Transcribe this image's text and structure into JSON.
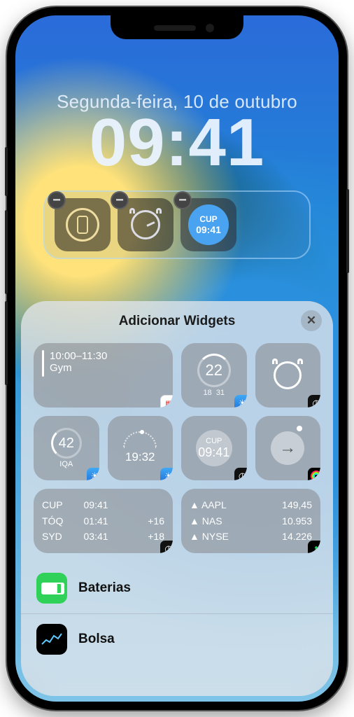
{
  "lockscreen": {
    "date": "Segunda-feira, 10 de outubro",
    "time": "09:41",
    "widgets": [
      {
        "kind": "phone-circle"
      },
      {
        "kind": "alarm"
      },
      {
        "kind": "worldclock",
        "city": "CUP",
        "time": "09:41"
      }
    ],
    "remove_glyph": "−"
  },
  "sheet": {
    "title": "Adicionar Widgets",
    "close_glyph": "✕",
    "grid": {
      "calendar_event": {
        "time": "10:00–11:30",
        "title": "Gym",
        "badge": "cal"
      },
      "temp": {
        "value": "22",
        "low": "18",
        "high": "31",
        "badge": "weather"
      },
      "alarm": {
        "badge": "clock"
      },
      "aqi": {
        "value": "42",
        "label": "IQA",
        "badge": "weather"
      },
      "sun": {
        "time": "19:32",
        "badge": "weather"
      },
      "wclock": {
        "city": "CUP",
        "time": "09:41",
        "badge": "clock"
      },
      "arrow": {
        "glyph": "→",
        "badge": "fitness"
      },
      "world_table": {
        "rows": [
          {
            "city": "CUP",
            "time": "09:41",
            "delta": ""
          },
          {
            "city": "TÓQ",
            "time": "01:41",
            "delta": "+16"
          },
          {
            "city": "SYD",
            "time": "03:41",
            "delta": "+18"
          }
        ],
        "badge": "clock"
      },
      "stocks_table": {
        "rows": [
          {
            "sym": "▲ AAPL",
            "val": "149,45"
          },
          {
            "sym": "▲ NAS",
            "val": "10.953"
          },
          {
            "sym": "▲ NYSE",
            "val": "14.226"
          }
        ],
        "badge": "stocks"
      }
    },
    "apps": [
      {
        "icon": "battery",
        "label": "Baterias"
      },
      {
        "icon": "stocks",
        "label": "Bolsa"
      }
    ]
  }
}
